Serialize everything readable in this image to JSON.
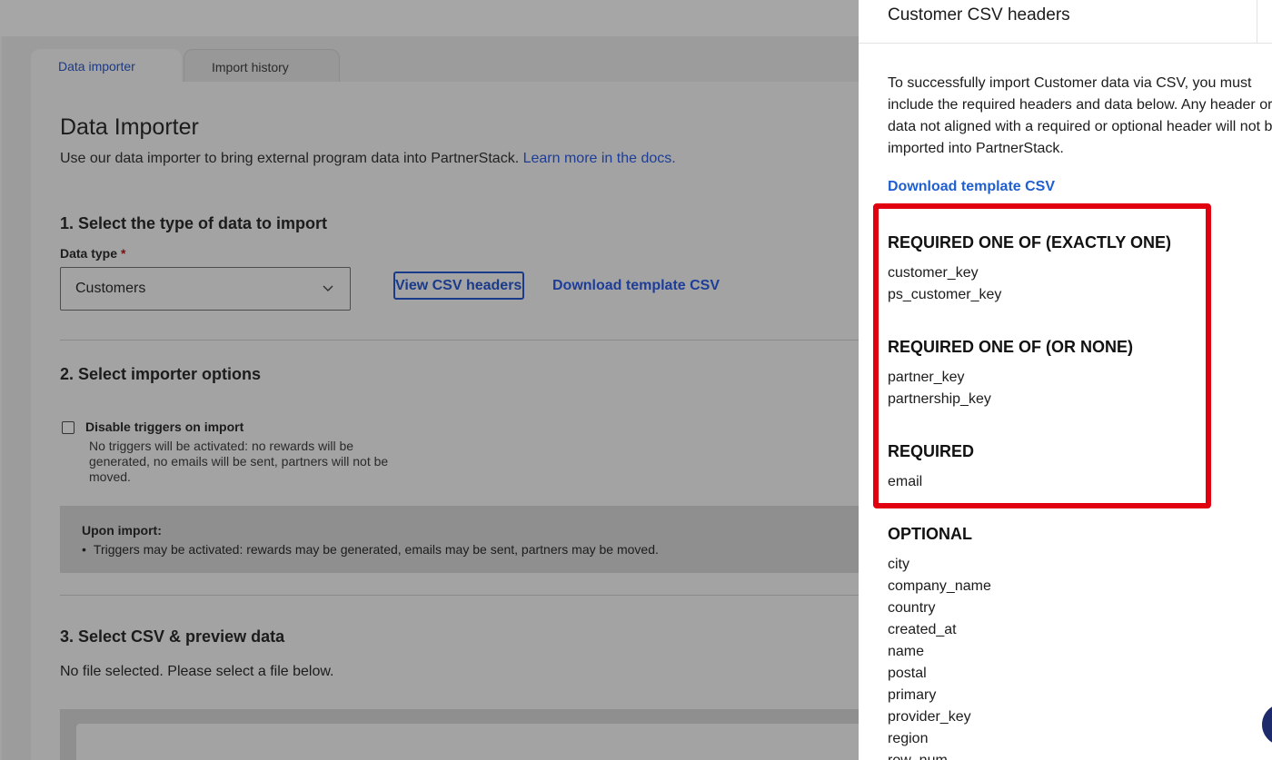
{
  "tabs": [
    {
      "label": "Data importer",
      "active": true
    },
    {
      "label": "Import history",
      "active": false
    }
  ],
  "page": {
    "title": "Data Importer",
    "subtitle": "Use our data importer to bring external program data into PartnerStack.",
    "subtitle_link": "Learn more in the docs."
  },
  "step1": {
    "heading": "1. Select the type of data to import",
    "data_type_label": "Data type",
    "required_mark": "*",
    "selected": "Customers",
    "view_headers_label": "View CSV headers",
    "download_template_label": "Download template CSV"
  },
  "step2": {
    "heading": "2. Select importer options",
    "checkbox_label": "Disable triggers on import",
    "checkbox_checked": false,
    "checkbox_help": "No triggers will be activated: no rewards will be generated, no emails will be sent, partners will not be moved.",
    "notice_heading": "Upon import:",
    "notice_item": "Triggers may be activated: rewards may be generated, emails may be sent, partners may be moved."
  },
  "step3": {
    "heading": "3. Select CSV & preview data",
    "status": "No file selected. Please select a file below."
  },
  "panel": {
    "title": "Customer CSV headers",
    "intro": "To successfully import Customer data via CSV, you must include the required headers and data below. Any header or data not aligned with a required or optional header will not be imported into PartnerStack.",
    "download_label": "Download template CSV",
    "groups": [
      {
        "heading": "REQUIRED ONE OF (EXACTLY ONE)",
        "fields": [
          "customer_key",
          "ps_customer_key"
        ]
      },
      {
        "heading": "REQUIRED ONE OF (OR NONE)",
        "fields": [
          "partner_key",
          "partnership_key"
        ]
      },
      {
        "heading": "REQUIRED",
        "fields": [
          "email"
        ]
      },
      {
        "heading": "OPTIONAL",
        "fields": [
          "city",
          "company_name",
          "country",
          "created_at",
          "name",
          "postal",
          "primary",
          "provider_key",
          "region",
          "row_num"
        ]
      }
    ]
  },
  "colors": {
    "highlight": "#e0000f",
    "link": "#1f5fcf",
    "overlay": "#a3a3a3"
  },
  "icons": [
    "chevron-down-icon",
    "chat-icon"
  ]
}
